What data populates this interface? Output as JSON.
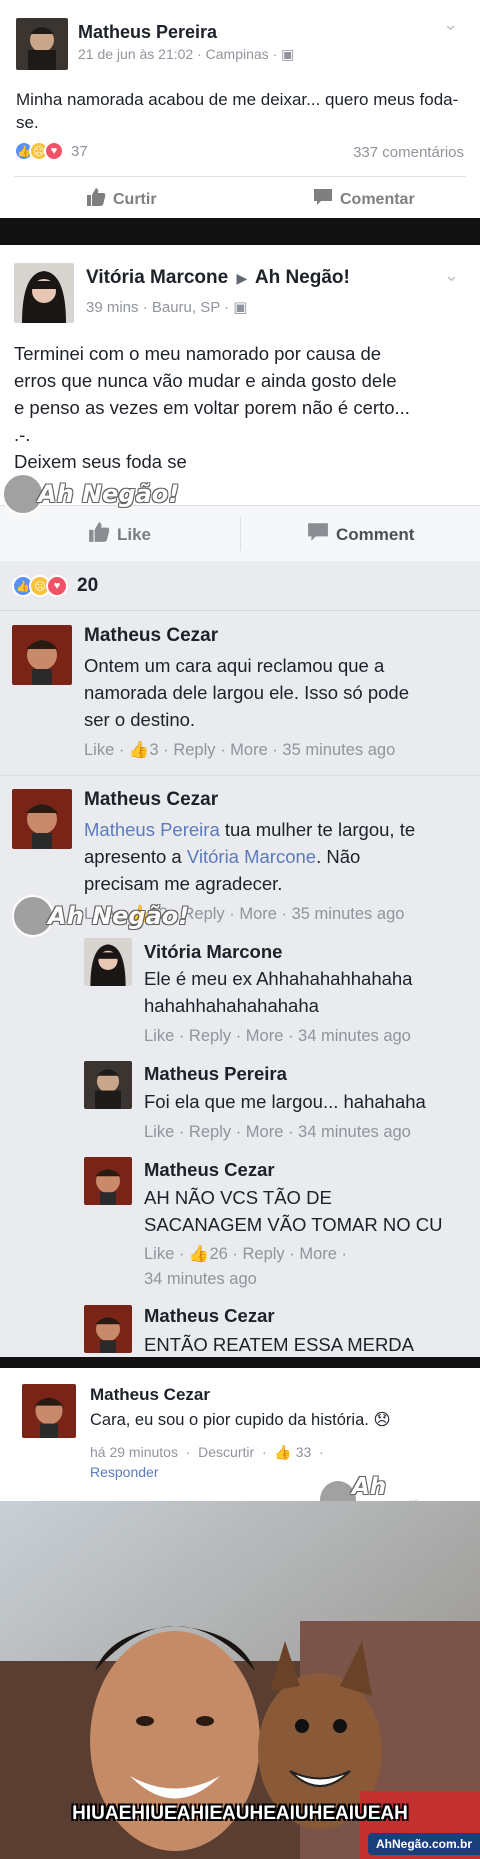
{
  "post1": {
    "author": "Matheus Pereira",
    "meta": "21 de jun às 21:02 · Campinas ·",
    "text": "Minha namorada acabou de me deixar... quero meus foda-se.",
    "reactions_count": "37",
    "comments_count": "337 comentários",
    "like_label": "Curtir",
    "comment_label": "Comentar"
  },
  "post2": {
    "author": "Vitória Marcone",
    "arrow": "▶",
    "target": "Ah Negão!",
    "meta": "39 mins · Bauru, SP ·",
    "text_lines": [
      "Terminei com o meu namorado por causa de",
      "erros que nunca vão mudar e ainda gosto dele",
      "e penso as vezes em voltar porem não é certo...",
      ".-.",
      "Deixem seus foda se"
    ],
    "like_label": "Like",
    "comment_label": "Comment",
    "reactions_count": "20"
  },
  "comments": [
    {
      "name": "Matheus Cezar",
      "lines": [
        "Ontem um cara aqui reclamou que a",
        "namorada dele largou ele. Isso só pode",
        "ser o destino."
      ],
      "meta": "Like · 👍3 · Reply · More · 35 minutes ago"
    },
    {
      "name": "Matheus Cezar",
      "mention1": "Matheus Pereira",
      "text1": " tua mulher te largou, te",
      "text2": "apresento a ",
      "mention2": "Vitória Marcone",
      "text3": ". Não",
      "text4": "precisam me agradecer.",
      "meta": "Like · 👍12 · Reply · More · 35 minutes ago"
    }
  ],
  "replies": [
    {
      "name": "Vitória Marcone",
      "lines": [
        "Ele é meu ex Ahhahahahhahaha",
        "hahahhahahahahaha"
      ],
      "meta": "Like · Reply · More · 34 minutes ago"
    },
    {
      "name": "Matheus Pereira",
      "lines": [
        "Foi ela que me largou... hahahaha"
      ],
      "meta": "Like · Reply · More · 34 minutes ago"
    },
    {
      "name": "Matheus Cezar",
      "lines": [
        "AH NÃO VCS TÃO DE",
        "SACANAGEM VÃO TOMAR NO CU"
      ],
      "meta": "Like · 👍26 · Reply · More ·",
      "meta2": "34 minutes ago"
    },
    {
      "name": "Matheus Cezar",
      "lines": [
        "ENTÃO REATEM ESSA MERDA"
      ]
    }
  ],
  "final_comment": {
    "name": "Matheus Cezar",
    "text": "Cara, eu sou o pior cupido da história. 😞",
    "meta": "há 29 minutos  ·  Descurtir  ·  👍 33  ·",
    "meta2": "Responder"
  },
  "photo": {
    "caption": "HIUAEHIUEAHIEAUHEAIUHEAIUEAH",
    "footer": "AhNegão.com.br"
  },
  "watermark": {
    "text": "Ah Negão!",
    "sub": ".Com.Br"
  },
  "colors": {
    "like_blue": "#5890ff",
    "sad_yellow": "#f7c23c",
    "love_red": "#f25268",
    "link_blue": "#5b7bbd",
    "meta_gray": "#90949c"
  }
}
